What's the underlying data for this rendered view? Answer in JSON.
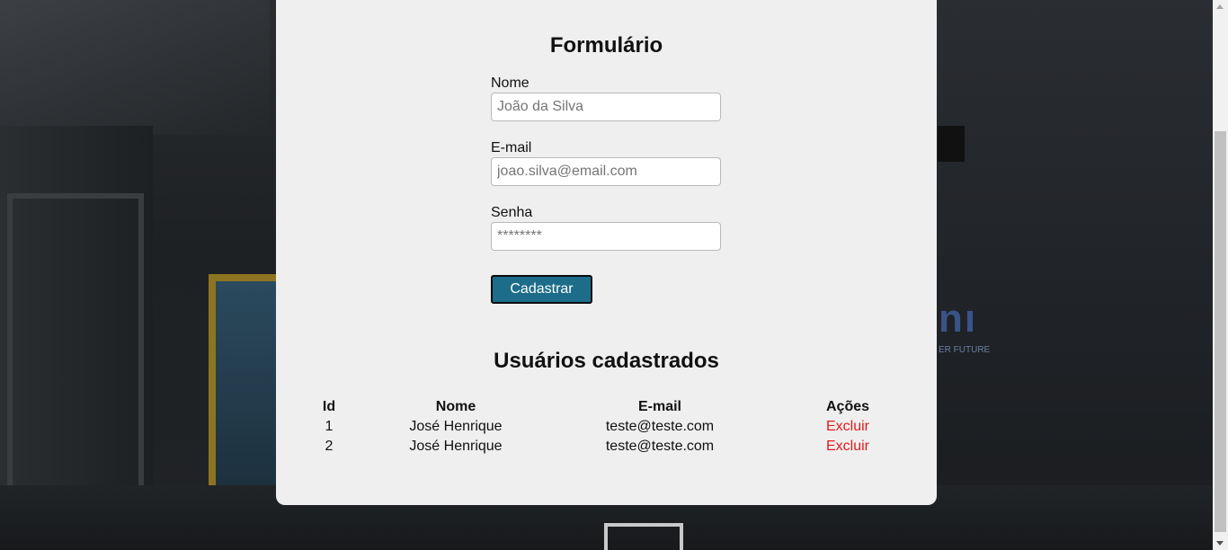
{
  "form": {
    "title": "Formulário",
    "name_label": "Nome",
    "name_placeholder": "João da Silva",
    "email_label": "E-mail",
    "email_placeholder": "joao.silva@email.com",
    "password_label": "Senha",
    "password_placeholder": "********",
    "submit_label": "Cadastrar"
  },
  "users": {
    "title": "Usuários cadastrados",
    "columns": [
      "Id",
      "Nome",
      "E-mail",
      "Ações"
    ],
    "rows": [
      {
        "id": "1",
        "name": "José Henrique",
        "email": "teste@teste.com",
        "action": "Excluir"
      },
      {
        "id": "2",
        "name": "José Henrique",
        "email": "teste@teste.com",
        "action": "Excluir"
      }
    ]
  },
  "background": {
    "sign_text": "nı",
    "sign_sub": "ER FUTURE"
  },
  "colors": {
    "button": "#1d6d8a",
    "delete_link": "#e41b1b",
    "card": "#efefef"
  }
}
